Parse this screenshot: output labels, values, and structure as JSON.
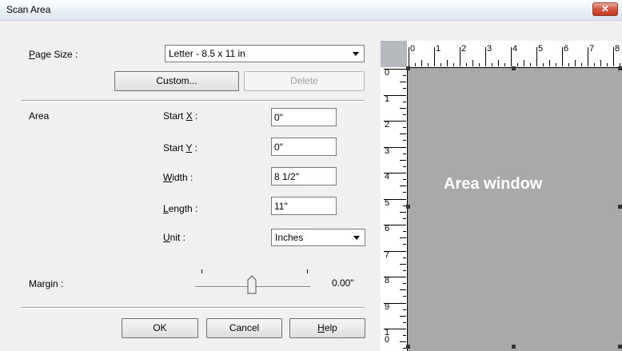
{
  "window": {
    "title": "Scan Area",
    "close_glyph": "✕"
  },
  "page_size": {
    "label_prefix": "",
    "label_ul": "P",
    "label_rest": "age Size :",
    "value": "Letter - 8.5 x 11 in"
  },
  "buttons": {
    "custom": "Custom...",
    "delete": "Delete",
    "ok": "OK",
    "cancel": "Cancel",
    "help_ul": "H",
    "help_rest": "elp"
  },
  "area": {
    "label": "Area",
    "start_x": {
      "pre": "Start ",
      "ul": "X",
      "post": " :",
      "value": "0\""
    },
    "start_y": {
      "pre": "Start ",
      "ul": "Y",
      "post": " :",
      "value": "0\""
    },
    "width": {
      "pre": "",
      "ul": "W",
      "post": "idth :",
      "value": "8 1/2\""
    },
    "length": {
      "pre": "",
      "ul": "L",
      "post": "ength :",
      "value": "11\""
    },
    "unit": {
      "pre": "",
      "ul": "U",
      "post": "nit :",
      "value": "Inches"
    }
  },
  "margin": {
    "pre": "Mar",
    "ul": "g",
    "post": "in :",
    "value": "0.00\"",
    "slider_fraction": 0.48
  },
  "preview": {
    "label": "Area window",
    "ruler_h": [
      "0",
      "1",
      "2",
      "3",
      "4",
      "5",
      "6",
      "7",
      "8"
    ],
    "ruler_v": [
      "0",
      "1",
      "2",
      "3",
      "4",
      "5",
      "6",
      "7",
      "8",
      "9",
      "1\n0"
    ]
  },
  "colors": {
    "area_fill": "#a9a9a9",
    "ruler_bg": "#ffffff",
    "title_bar": "#dde4ee"
  }
}
